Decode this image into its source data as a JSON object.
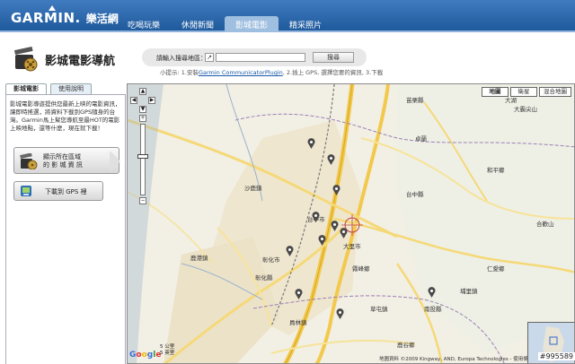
{
  "brand": {
    "logo": "GARMIN.",
    "subtitle": "樂活網"
  },
  "nav": [
    "吃喝玩樂",
    "休閒新聞",
    "影城電影",
    "精采照片"
  ],
  "app": {
    "title": "影城電影導航"
  },
  "search": {
    "label": "請輸入搜尋地區：",
    "icon_glyph": "↗",
    "button": "搜尋",
    "value": ""
  },
  "hint": {
    "prefix": "小提示: 1.安裝",
    "link": "Garmin CommunicatorPlugin",
    "suffix": ", 2.插上 GPS, 選擇您要的資訊, 3.下載"
  },
  "tabs": [
    "影城電影",
    "使用說明"
  ],
  "panel": {
    "description": "影城電影導遊提供您最新上映的電影資訊，讓即時搖選，將資料下載到GPS隨身的台灣。Garmin馬上幫您導航至最HOT的電影上映地點，還等什麼，現在就下載！",
    "show_button": "顯示所在區域\n的 影 城 資 訊",
    "download_button": "下載到 GPS 裡"
  },
  "map": {
    "types": [
      "地圖",
      "衛星",
      "混合地圖"
    ],
    "labels": {
      "miaoli": "苗栗縣",
      "taichung_county": "台中縣",
      "changhua": "彰化縣",
      "nantou": "南投縣",
      "dahu": "大湖",
      "dahu2": "大霸尖山",
      "sanwan": "卓蘭",
      "taichung_city": "台中市",
      "dali": "大里市",
      "wufeng": "霧峰鄉",
      "caotun": "草屯鎮",
      "renai": "仁愛鄉",
      "puli": "埔里鎮",
      "heping": "和平鄉",
      "shalu": "沙鹿鎮",
      "lukang": "鹿港鎮",
      "changhua_city": "彰化市",
      "yuanlin": "員林鎮",
      "lugu": "鹿谷鄉",
      "hoffman": "合歡山"
    },
    "google": "Google",
    "scale_top": "5 公里",
    "scale_bottom": "5 英里",
    "copyright": "地圖資料 ©2009 Kingway, AND, Europa Technologies - 使用條款"
  },
  "photo_id": "#995589",
  "colors": {
    "topbar": "#1f5a9c",
    "road_major": "#f2c94c",
    "pin": "#4a4a4a",
    "link": "#1a5aa8"
  }
}
